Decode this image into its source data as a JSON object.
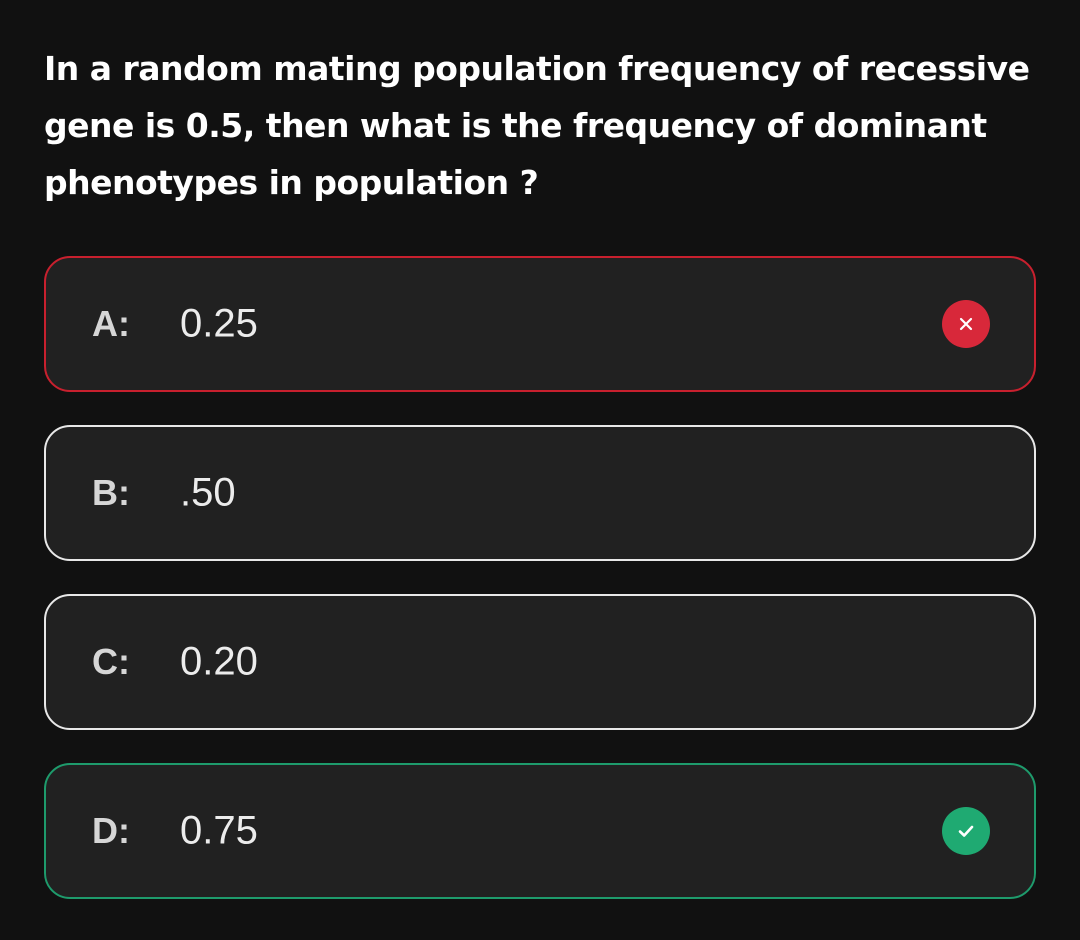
{
  "question": {
    "line1": "In a random mating population frequency of recessive",
    "line2": "gene is 0.5, then what is the frequency of dominant",
    "line3": "phenotypes in population ?"
  },
  "options": [
    {
      "letter": "A:",
      "value": "0.25",
      "state": "wrong",
      "icon": "close-icon"
    },
    {
      "letter": "B:",
      "value": ".50",
      "state": "neutral"
    },
    {
      "letter": "C:",
      "value": "0.20",
      "state": "neutral"
    },
    {
      "letter": "D:",
      "value": "0.75",
      "state": "correct",
      "icon": "check-icon"
    }
  ],
  "colors": {
    "background": "#111111",
    "option_background": "#212121",
    "wrong": "#d8283a",
    "correct": "#1faa72",
    "neutral_border": "#e8e8e8"
  }
}
